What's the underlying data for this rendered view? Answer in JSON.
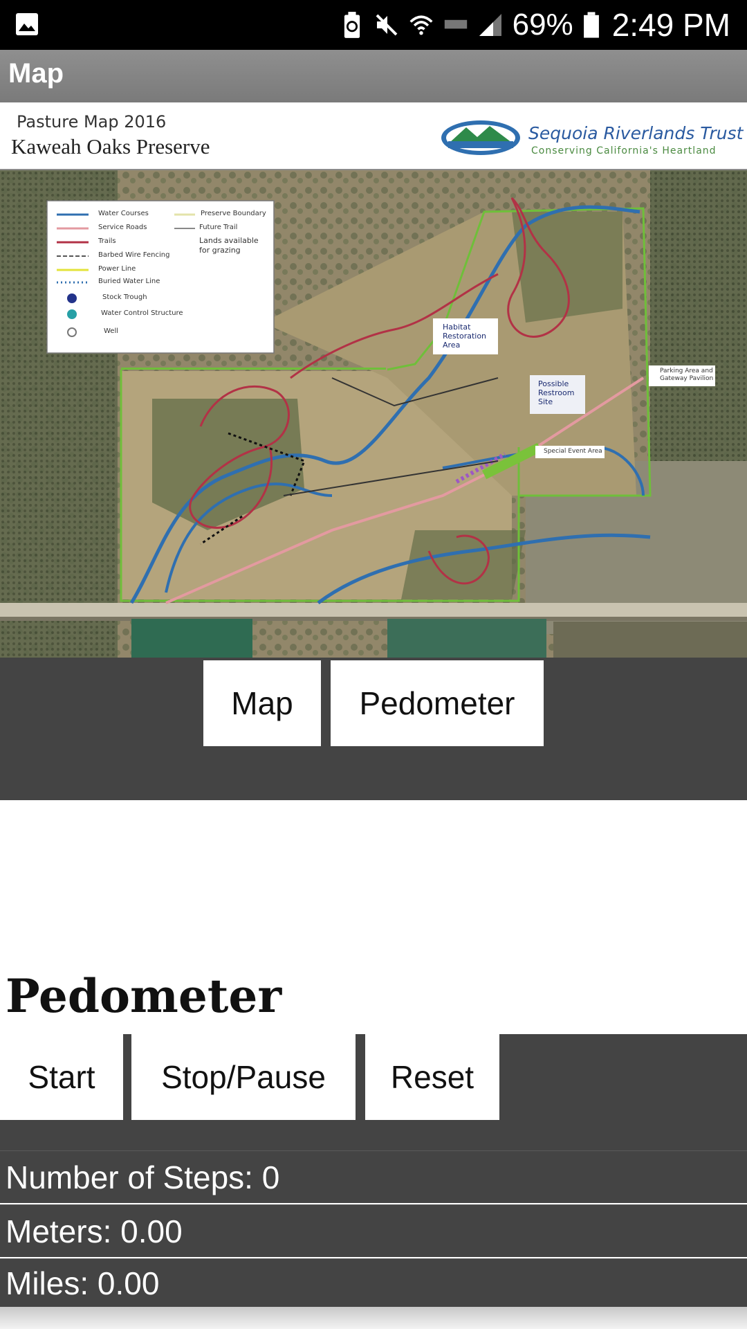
{
  "status_bar": {
    "battery_percent": "69%",
    "time": "2:49 PM",
    "icons": [
      "gallery-icon",
      "battery-saver-icon",
      "mute-icon",
      "wifi-icon",
      "lte-icon",
      "signal-icon",
      "battery-icon"
    ]
  },
  "action_bar": {
    "title": "Map"
  },
  "map": {
    "header_subtitle": "Pasture Map 2016",
    "header_title": "Kaweah Oaks Preserve",
    "org_name": "Sequoia Riverlands Trust",
    "org_tagline": "Conserving California's Heartland",
    "legend": {
      "col1": [
        "Water Courses",
        "Service Roads",
        "Trails",
        "Barbed Wire Fencing",
        "Power Line",
        "Buried Water Line",
        "Stock Trough",
        "Water Control Structure",
        "Well"
      ],
      "col2": [
        "Preserve Boundary",
        "Future Trail",
        "Lands available",
        "for grazing"
      ]
    },
    "callouts": {
      "habitat": [
        "Habitat",
        "Restoration",
        "Area"
      ],
      "restroom": [
        "Possible",
        "Restroom",
        "Site"
      ],
      "parking": [
        "Parking Area and",
        "Gateway Pavilion"
      ],
      "special_event": "Special Event Area"
    },
    "colors": {
      "water": "#2f6fb0",
      "service_roads": "#e39aa0",
      "trails": "#b23246",
      "boundary": "#6fbf3a"
    }
  },
  "nav": {
    "map_label": "Map",
    "pedometer_label": "Pedometer"
  },
  "pedometer": {
    "title": "Pedometer",
    "start_label": "Start",
    "stop_label": "Stop/Pause",
    "reset_label": "Reset",
    "steps_text": "Number of Steps: 0",
    "meters_text": "Meters: 0.00",
    "miles_text": "Miles: 0.00"
  }
}
